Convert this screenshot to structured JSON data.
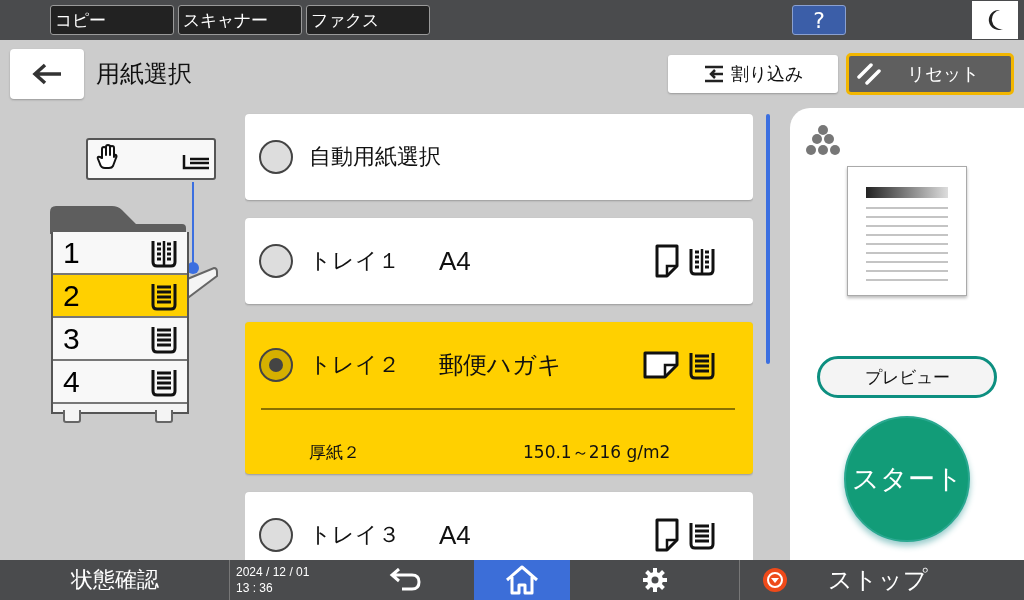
{
  "app_tabs": [
    {
      "label": "コピー"
    },
    {
      "label": "スキャナー"
    },
    {
      "label": "ファクス"
    }
  ],
  "help_button": {
    "label": "?"
  },
  "header": {
    "title": "用紙選択",
    "interrupt_button": "割り込み",
    "reset_button": "リセット"
  },
  "machine_diagram": {
    "trays": [
      {
        "label": "1",
        "kind": "split",
        "selected": false
      },
      {
        "label": "2",
        "kind": "stack",
        "selected": true
      },
      {
        "label": "3",
        "kind": "stack",
        "selected": false
      },
      {
        "label": "4",
        "kind": "stack",
        "selected": false
      }
    ]
  },
  "paper_options": [
    {
      "label": "自動用紙選択",
      "kind": "auto",
      "selected": false
    },
    {
      "label": "トレイ１",
      "kind": "tray",
      "size": "A4",
      "paper_icon": {
        "kind": "portrait"
      },
      "tray_icon": {
        "kind": "split"
      },
      "selected": false
    },
    {
      "label": "トレイ２",
      "kind": "tray",
      "size": "郵便ハガキ",
      "paper_icon": {
        "kind": "landscape"
      },
      "tray_icon": {
        "kind": "stack"
      },
      "selected": true,
      "paper_type": "厚紙２",
      "weight": "150.1～216 g/m2"
    },
    {
      "label": "トレイ３",
      "kind": "tray",
      "size": "A4",
      "paper_icon": {
        "kind": "portrait"
      },
      "tray_icon": {
        "kind": "stack"
      },
      "selected": false
    }
  ],
  "side_panel": {
    "preview_button": "プレビュー",
    "start_button": "スタート"
  },
  "status_bar": {
    "status_button": "状態確認",
    "date": "2024 / 12 / 01",
    "time": "13 : 36",
    "stop_button": "ストップ"
  }
}
